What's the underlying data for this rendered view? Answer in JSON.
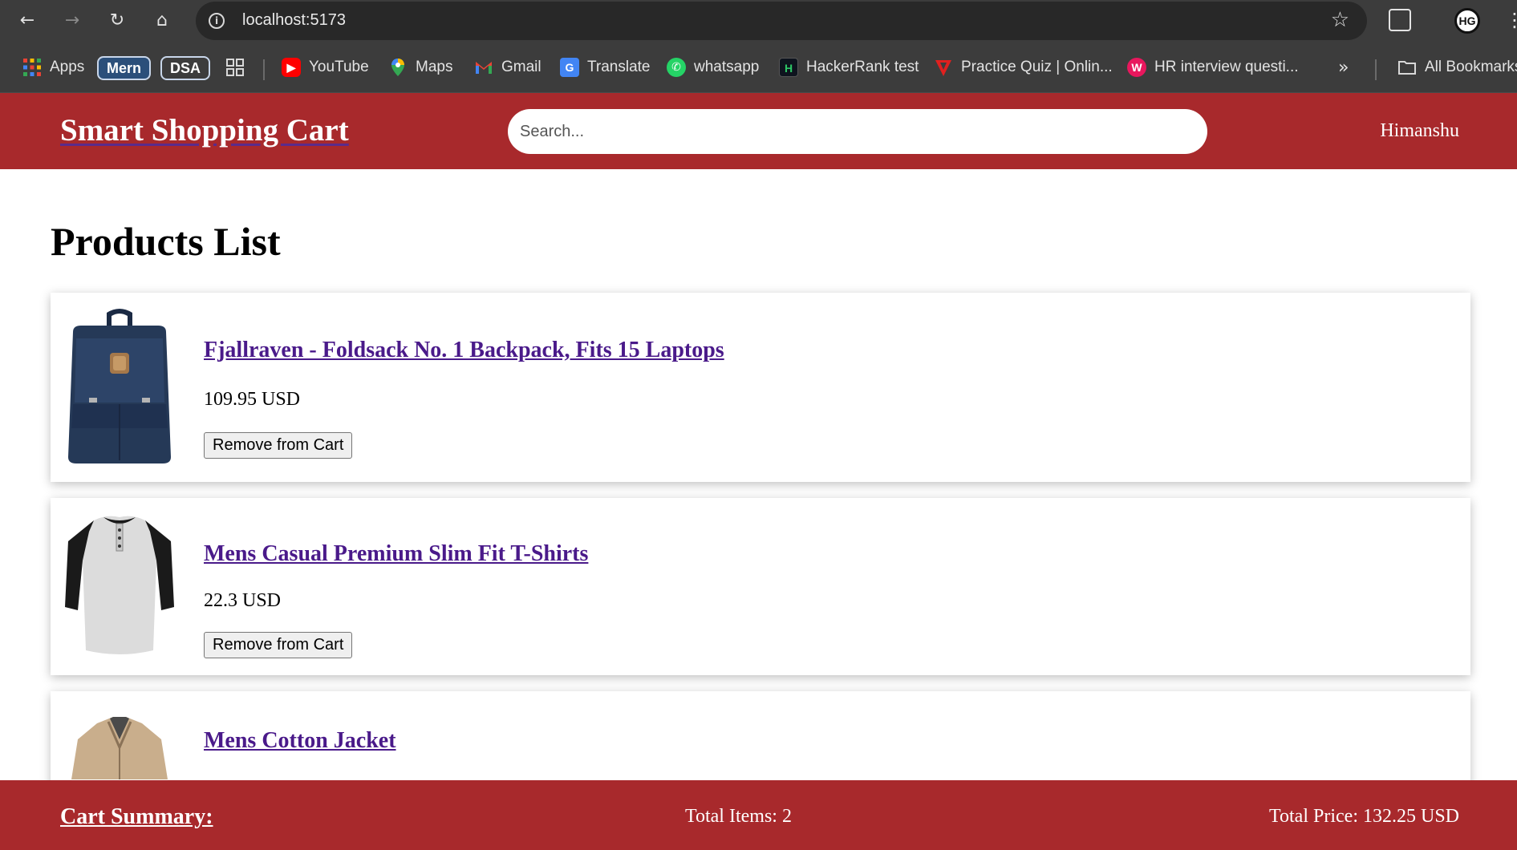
{
  "browser": {
    "url": "localhost:5173",
    "bookmarks": [
      {
        "label": "Apps",
        "icon": "apps-grid-icon"
      },
      {
        "label": "Mern",
        "icon": "folder-chip"
      },
      {
        "label": "DSA",
        "icon": "folder-chip"
      },
      {
        "label": "YouTube",
        "icon": "youtube-icon"
      },
      {
        "label": "Maps",
        "icon": "maps-icon"
      },
      {
        "label": "Gmail",
        "icon": "gmail-icon"
      },
      {
        "label": "Translate",
        "icon": "translate-icon"
      },
      {
        "label": "whatsapp",
        "icon": "whatsapp-icon"
      },
      {
        "label": "HackerRank test",
        "icon": "hackerrank-icon"
      },
      {
        "label": "Practice Quiz | Onlin...",
        "icon": "quiz-icon"
      },
      {
        "label": "HR interview questi...",
        "icon": "hr-icon"
      }
    ],
    "overflow_label": "»",
    "all_bookmarks_label": "All Bookmarks"
  },
  "header": {
    "brand": "Smart Shopping Cart",
    "search_placeholder": "Search...",
    "user": "Himanshu"
  },
  "main": {
    "title": "Products List",
    "products": [
      {
        "title": "Fjallraven - Foldsack No. 1 Backpack, Fits 15 Laptops",
        "price": "109.95 USD",
        "button": "Remove from Cart",
        "image": "backpack-image"
      },
      {
        "title": "Mens Casual Premium Slim Fit T-Shirts",
        "price": "22.3 USD",
        "button": "Remove from Cart",
        "image": "tshirt-image"
      },
      {
        "title": "Mens Cotton Jacket",
        "price": "",
        "button": "",
        "image": "jacket-image"
      }
    ]
  },
  "footer": {
    "summary_title": "Cart Summary:",
    "total_items": "Total Items: 2",
    "total_price": "Total Price: 132.25 USD"
  },
  "colors": {
    "brand_red": "#a8292c",
    "chrome_dark": "#3c3c3c",
    "link_purple": "#4a1a8a"
  }
}
